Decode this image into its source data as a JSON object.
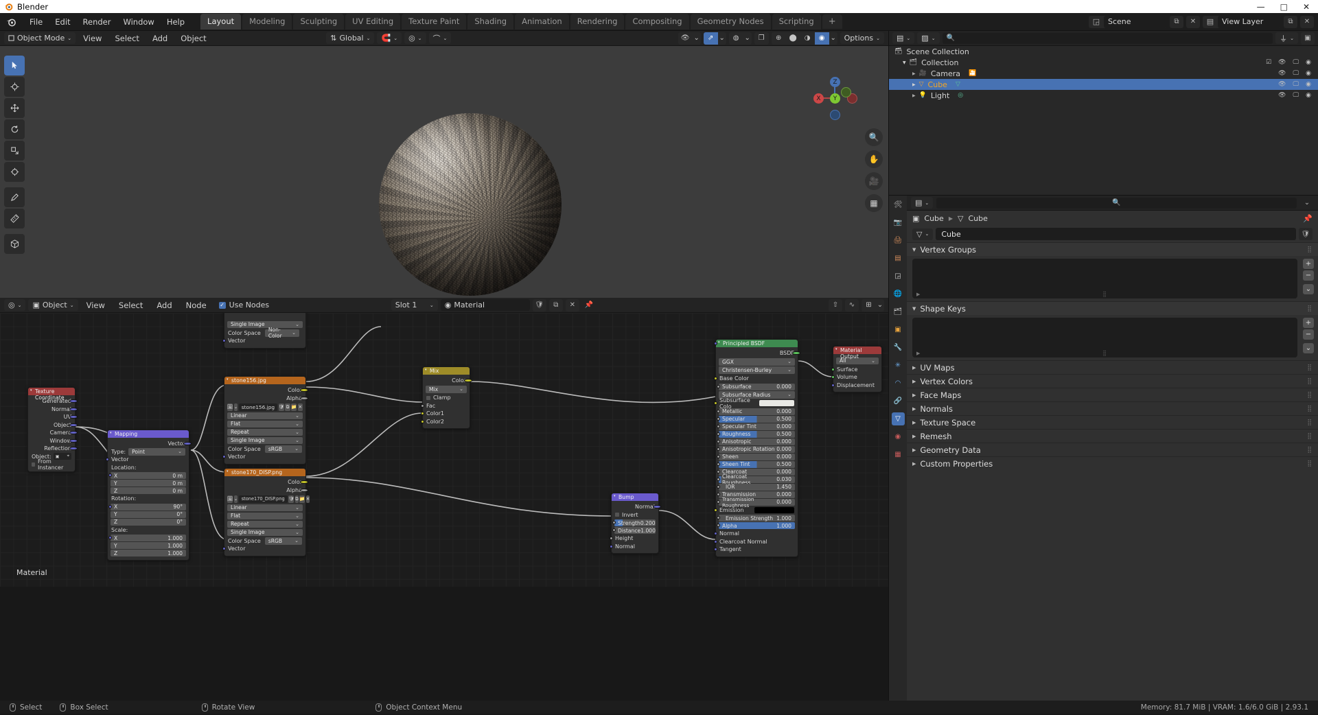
{
  "window": {
    "title": "Blender",
    "minimize": "—",
    "maximize": "□",
    "close": "✕"
  },
  "topbar": {
    "menus": [
      "File",
      "Edit",
      "Render",
      "Window",
      "Help"
    ],
    "workspaces": [
      {
        "label": "Layout",
        "active": true
      },
      {
        "label": "Modeling",
        "active": false
      },
      {
        "label": "Sculpting",
        "active": false
      },
      {
        "label": "UV Editing",
        "active": false
      },
      {
        "label": "Texture Paint",
        "active": false
      },
      {
        "label": "Shading",
        "active": false
      },
      {
        "label": "Animation",
        "active": false
      },
      {
        "label": "Rendering",
        "active": false
      },
      {
        "label": "Compositing",
        "active": false
      },
      {
        "label": "Geometry Nodes",
        "active": false
      },
      {
        "label": "Scripting",
        "active": false
      }
    ],
    "add_workspace": "+",
    "scene_name": "Scene",
    "view_layer_name": "View Layer",
    "scene_icon": "scene-icon",
    "viewlayer_icon": "view-layer-icon"
  },
  "viewport_header": {
    "mode": "Object Mode",
    "menus": [
      "View",
      "Select",
      "Add",
      "Object"
    ],
    "transform_orientation": "Global",
    "snapping_icon": "magnet-icon",
    "proportional_icon": "proportional-editing-icon",
    "falloff_icon": "falloff-curve-icon",
    "options": "Options",
    "shading_modes": [
      "wireframe",
      "solid",
      "material-preview",
      "rendered"
    ],
    "active_shading": "rendered",
    "overlays_icon": "overlays-icon",
    "xray_icon": "xray-icon",
    "gizmo_icon": "gizmo-icon",
    "visibility_icon": "visibility-icon"
  },
  "toolbar": {
    "tools": [
      "select-box-tool",
      "cursor-tool",
      "move-tool",
      "rotate-tool",
      "scale-tool",
      "transform-tool",
      "annotate-tool",
      "measure-tool",
      "add-cube-tool"
    ],
    "active_tool": "select-box-tool"
  },
  "gizmo": {
    "x": "X",
    "y": "Y",
    "z": "Z"
  },
  "nav": {
    "zoom_icon": "zoom-icon",
    "pan_icon": "hand-icon",
    "camera_icon": "camera-icon",
    "ortho_icon": "orthographic-icon"
  },
  "node_editor": {
    "editor_type_icon": "shader-editor-icon",
    "shader_type": "Object",
    "menus": [
      "View",
      "Select",
      "Add",
      "Node"
    ],
    "use_nodes_label": "Use Nodes",
    "use_nodes_checked": true,
    "slot": "Slot 1",
    "material_name": "Material",
    "material_icon": "material-icon",
    "shield_icon": "fake-user-icon",
    "copy_icon": "new-material-icon",
    "unlink_icon": "unlink-icon",
    "pin_icon": "pin-icon",
    "footer_label": "Material",
    "snap_icon": "snap-icon",
    "overlay_icon": "node-overlay-icon",
    "nodes": [
      {
        "name": "Texture Coordinate",
        "header_color": "#9c3a3a",
        "outputs": [
          "Generated",
          "Normal",
          "UV",
          "Object",
          "Camera",
          "Window",
          "Reflection"
        ],
        "object_label": "Object:",
        "from_instancer_label": "From Instancer"
      },
      {
        "name": "Mapping",
        "header_color": "#6a5acd",
        "output_label": "Vector",
        "type_label": "Type:",
        "type_value": "Point",
        "vector_label": "Vector",
        "location_label": "Location:",
        "location": [
          {
            "axis": "X",
            "value": "0 m"
          },
          {
            "axis": "Y",
            "value": "0 m"
          },
          {
            "axis": "Z",
            "value": "0 m"
          }
        ],
        "rotation_label": "Rotation:",
        "rotation": [
          {
            "axis": "X",
            "value": "90°"
          },
          {
            "axis": "Y",
            "value": "0°"
          },
          {
            "axis": "Z",
            "value": "0°"
          }
        ],
        "scale_label": "Scale:",
        "scale": [
          {
            "axis": "X",
            "value": "1.000"
          },
          {
            "axis": "Y",
            "value": "1.000"
          },
          {
            "axis": "Z",
            "value": "1.000"
          }
        ]
      },
      {
        "name": "stone156.jpg",
        "header_color": "#b5651d",
        "outputs": [
          "Color",
          "Alpha"
        ],
        "image_name": "stone156.jpg",
        "interpolation": "Linear",
        "projection": "Flat",
        "extension": "Repeat",
        "source": "Single Image",
        "colorspace_label": "Color Space",
        "colorspace_value": "sRGB",
        "vector_label": "Vector"
      },
      {
        "name": "stone170_DISP.png",
        "header_color": "#b5651d",
        "outputs": [
          "Color",
          "Alpha"
        ],
        "image_name": "stone170_DISP.png",
        "interpolation": "Linear",
        "projection": "Flat",
        "extension": "Repeat",
        "source": "Single Image",
        "colorspace_label": "Color Space",
        "colorspace_value": "sRGB",
        "vector_label": "Vector"
      },
      {
        "name": "hidden-top-node",
        "header_color": "#b5651d",
        "source": "Single Image",
        "colorspace_label": "Color Space",
        "colorspace_value": "Non-Color",
        "vector_label": "Vector"
      },
      {
        "name": "Mix",
        "header_color": "#9e8c28",
        "output_label": "Color",
        "blend_mode": "Mix",
        "clamp_label": "Clamp",
        "inputs": [
          "Fac",
          "Color1",
          "Color2"
        ]
      },
      {
        "name": "Bump",
        "header_color": "#6a5acd",
        "output_label": "Normal",
        "invert_label": "Invert",
        "strength_label": "Strength",
        "strength_value": "0.200",
        "distance_label": "Distance",
        "distance_value": "1.000",
        "inputs": [
          "Height",
          "Normal"
        ]
      },
      {
        "name": "Principled BSDF",
        "header_color": "#3e8b50",
        "output_label": "BSDF",
        "distribution": "GGX",
        "subsurface_method": "Christensen-Burley",
        "props": [
          {
            "label": "Base Color",
            "value": "",
            "type": "socket",
            "sock": "yellow"
          },
          {
            "label": "Subsurface",
            "value": "0.000",
            "type": "field",
            "pct": 0
          },
          {
            "label": "Subsurface Radius",
            "value": "",
            "type": "drop",
            "sock": "purple"
          },
          {
            "label": "Subsurface Colo",
            "value": "",
            "type": "swatch",
            "color": "#e8e8e4",
            "sock": "yellow"
          },
          {
            "label": "Metallic",
            "value": "0.000",
            "type": "field",
            "pct": 0
          },
          {
            "label": "Specular",
            "value": "0.500",
            "type": "slider",
            "pct": 50
          },
          {
            "label": "Specular Tint",
            "value": "0.000",
            "type": "field",
            "pct": 0
          },
          {
            "label": "Roughness",
            "value": "0.500",
            "type": "slider",
            "pct": 50
          },
          {
            "label": "Anisotropic",
            "value": "0.000",
            "type": "field",
            "pct": 0
          },
          {
            "label": "Anisotropic Rotation",
            "value": "0.000",
            "type": "field",
            "pct": 0
          },
          {
            "label": "Sheen",
            "value": "0.000",
            "type": "field",
            "pct": 0
          },
          {
            "label": "Sheen Tint",
            "value": "0.500",
            "type": "slider",
            "pct": 50
          },
          {
            "label": "Clearcoat",
            "value": "0.000",
            "type": "field",
            "pct": 0
          },
          {
            "label": "Clearcoat Roughness",
            "value": "0.030",
            "type": "slider",
            "pct": 3
          },
          {
            "label": "IOR",
            "value": "1.450",
            "type": "field",
            "pct": 0
          },
          {
            "label": "Transmission",
            "value": "0.000",
            "type": "field",
            "pct": 0
          },
          {
            "label": "Transmission Roughness",
            "value": "0.000",
            "type": "field",
            "pct": 0
          },
          {
            "label": "Emission",
            "value": "",
            "type": "swatch",
            "color": "#000000",
            "sock": "yellow"
          },
          {
            "label": "Emission Strength",
            "value": "1.000",
            "type": "field",
            "pct": 0
          },
          {
            "label": "Alpha",
            "value": "1.000",
            "type": "slider",
            "pct": 100
          },
          {
            "label": "Normal",
            "value": "",
            "type": "socket",
            "sock": "purple"
          },
          {
            "label": "Clearcoat Normal",
            "value": "",
            "type": "socket",
            "sock": "purple"
          },
          {
            "label": "Tangent",
            "value": "",
            "type": "socket",
            "sock": "purple"
          }
        ]
      },
      {
        "name": "Material Output",
        "header_color": "#9c3a3a",
        "target": "All",
        "inputs": [
          "Surface",
          "Volume",
          "Displacement"
        ]
      }
    ]
  },
  "outliner": {
    "filter_icon": "filter-icon",
    "display_mode_icon": "display-mode-icon",
    "search_placeholder": "",
    "scene_collection": "Scene Collection",
    "rows": [
      {
        "label": "Collection",
        "depth": 1,
        "icon": "collection-icon",
        "selected": false,
        "has_checkbox": true
      },
      {
        "label": "Camera",
        "depth": 2,
        "icon": "camera-icon",
        "selected": false,
        "has_checkbox": false
      },
      {
        "label": "Cube",
        "depth": 2,
        "icon": "mesh-icon",
        "selected": true,
        "has_checkbox": false
      },
      {
        "label": "Light",
        "depth": 2,
        "icon": "light-icon",
        "selected": false,
        "has_checkbox": false
      }
    ]
  },
  "properties": {
    "search_placeholder": "",
    "tabs": [
      "tool-icon",
      "render-icon",
      "output-icon",
      "view-layer-icon",
      "scene-icon",
      "world-icon",
      "collection-icon",
      "object-icon",
      "modifier-icon",
      "particles-icon",
      "physics-icon",
      "constraints-icon",
      "data-icon",
      "material-icon",
      "texture-icon"
    ],
    "active_tab": "data-icon",
    "breadcrumb": [
      "Cube",
      "Cube"
    ],
    "object_name": "Cube",
    "panels": [
      {
        "label": "Vertex Groups",
        "open": true,
        "has_list": true
      },
      {
        "label": "Shape Keys",
        "open": true,
        "has_list": true
      },
      {
        "label": "UV Maps",
        "open": false,
        "has_list": false
      },
      {
        "label": "Vertex Colors",
        "open": false,
        "has_list": false
      },
      {
        "label": "Face Maps",
        "open": false,
        "has_list": false
      },
      {
        "label": "Normals",
        "open": false,
        "has_list": false
      },
      {
        "label": "Texture Space",
        "open": false,
        "has_list": false
      },
      {
        "label": "Remesh",
        "open": false,
        "has_list": false
      },
      {
        "label": "Geometry Data",
        "open": false,
        "has_list": false
      },
      {
        "label": "Custom Properties",
        "open": false,
        "has_list": false
      }
    ],
    "add_btn": "+",
    "remove_btn": "−",
    "menu_btn": "⌄"
  },
  "statusbar": {
    "items": [
      {
        "icon": "left-mouse-icon",
        "label": "Select"
      },
      {
        "icon": "left-mouse-drag-icon",
        "label": "Box Select"
      },
      {
        "icon": "middle-mouse-icon",
        "label": "Rotate View"
      },
      {
        "icon": "right-mouse-icon",
        "label": "Object Context Menu"
      }
    ],
    "memory": "Memory: 81.7 MiB | VRAM: 1.6/6.0 GiB | 2.93.1"
  },
  "colors": {
    "accent": "#4772b3",
    "orange": "#e87d0d",
    "panel_bg": "#303030",
    "editor_bg": "#1c1c1c"
  }
}
